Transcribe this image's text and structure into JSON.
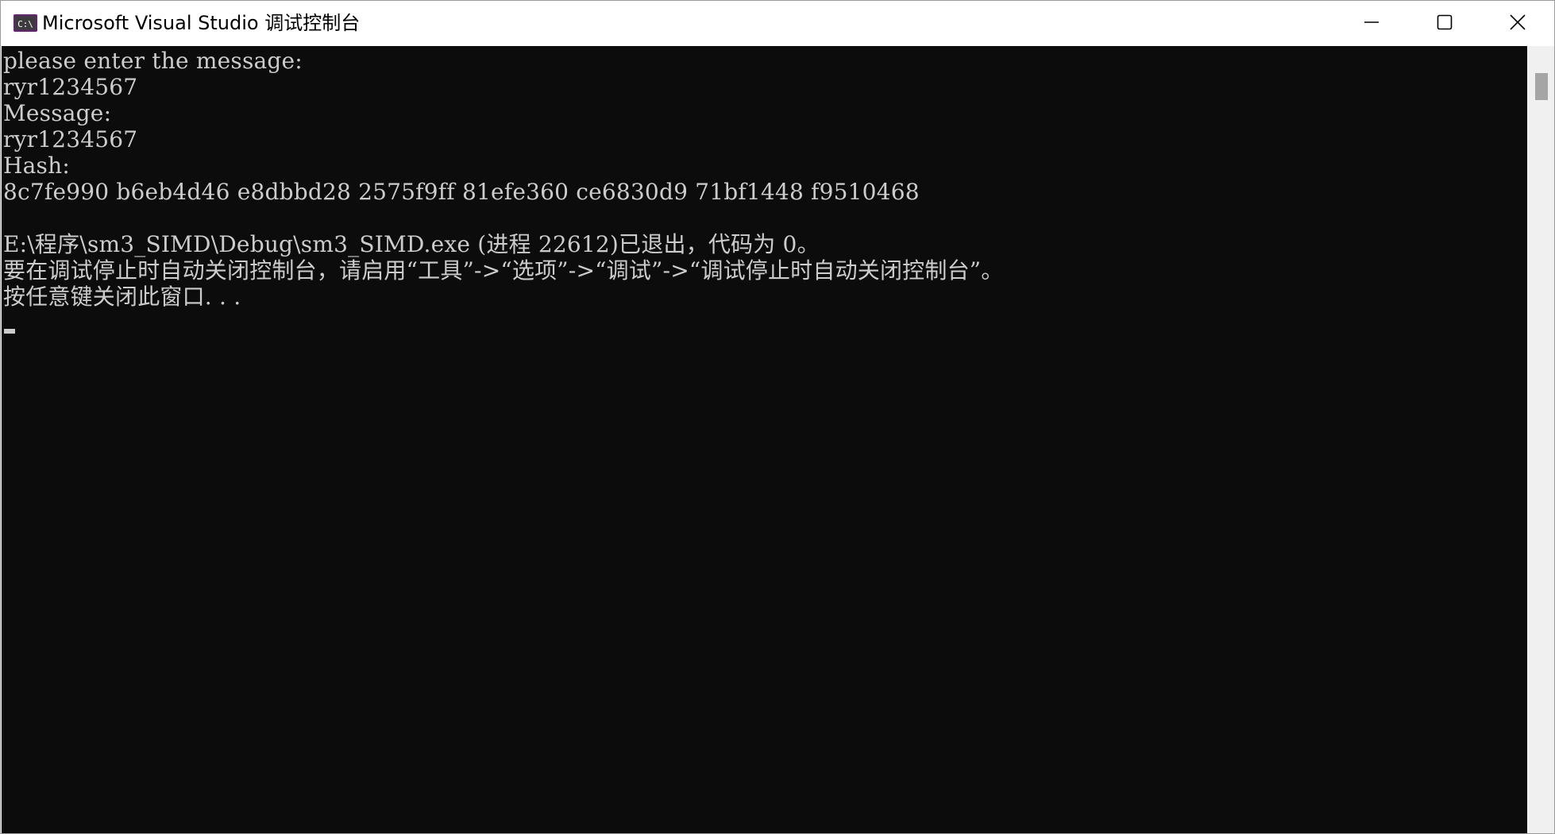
{
  "window": {
    "title": "Microsoft Visual Studio 调试控制台",
    "icon": "console-app-icon",
    "icon_label": "C:\\",
    "controls": {
      "minimize_icon": "minimize-icon",
      "maximize_icon": "maximize-icon",
      "close_icon": "close-icon"
    }
  },
  "console": {
    "background": "#0c0c0c",
    "foreground": "#cccccc",
    "lines": [
      "please enter the message:",
      "ryr1234567",
      "Message:",
      "ryr1234567",
      "Hash:",
      "8c7fe990 b6eb4d46 e8dbbd28 2575f9ff 81efe360 ce6830d9 71bf1448 f9510468",
      "",
      "E:\\程序\\sm3_SIMD\\Debug\\sm3_SIMD.exe (进程 22612)已退出，代码为 0。",
      "要在调试停止时自动关闭控制台，请启用“工具”->“选项”->“调试”->“调试停止时自动关闭控制台”。",
      "按任意键关闭此窗口. . ."
    ]
  }
}
